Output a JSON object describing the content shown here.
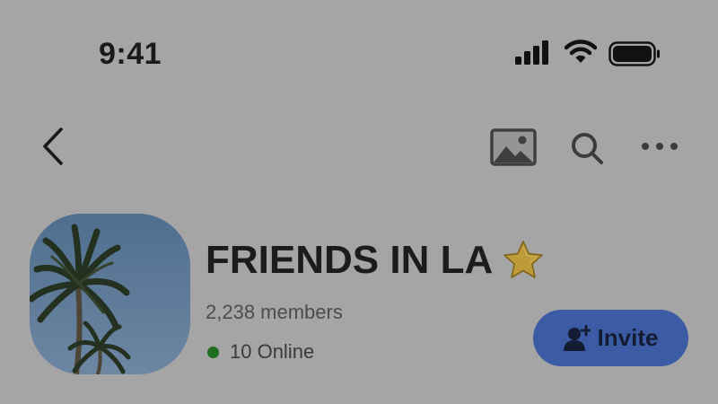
{
  "status_bar": {
    "time": "9:41",
    "icons": [
      "cellular-signal-icon",
      "wifi-icon",
      "battery-icon"
    ]
  },
  "nav": {
    "icons": [
      "back-chevron-icon",
      "gallery-icon",
      "search-icon",
      "more-options-icon"
    ]
  },
  "group": {
    "name": "FRIENDS IN LA",
    "emoji": "star-emoji",
    "members": "2,238 members",
    "online": "10 Online",
    "online_color": "#1f6e1f",
    "avatar": "palm-trees-photo"
  },
  "invite_button": {
    "label": "Invite",
    "icon": "add-person-icon",
    "color": "#3c5ba5"
  }
}
